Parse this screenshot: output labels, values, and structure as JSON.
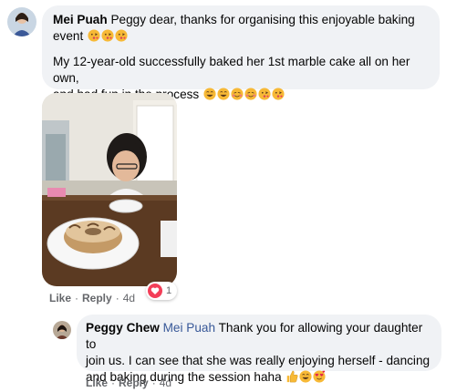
{
  "comment1": {
    "author": "Mei Puah",
    "text_line1": "Peggy dear, thanks for organising this enjoyable baking",
    "text_line2": "event",
    "text_p2_line1": "My 12-year-old successfully baked her 1st marble cake all on her own,",
    "text_p2_line2": "and had fun in the process",
    "actions": {
      "like": "Like",
      "reply": "Reply",
      "time": "4d"
    },
    "reaction_count": "1"
  },
  "reply1": {
    "author": "Peggy Chew",
    "mention": "Mei Puah",
    "text_line1": "Thank you for allowing your daughter to",
    "text_line2": "join us. I can see that she was really enjoying herself - dancing",
    "text_line3": "and baking during the session haha",
    "actions": {
      "like": "Like",
      "reply": "Reply",
      "time": "4d"
    }
  },
  "colors": {
    "bubble": "#f0f2f5",
    "mention": "#385898",
    "meta": "#65676b",
    "reaction": "#f33e58"
  },
  "icons": [
    "kiss-emoji-icon",
    "grin-emoji-icon",
    "blush-emoji-icon",
    "thumbs-up-icon",
    "heart-reaction-icon"
  ]
}
